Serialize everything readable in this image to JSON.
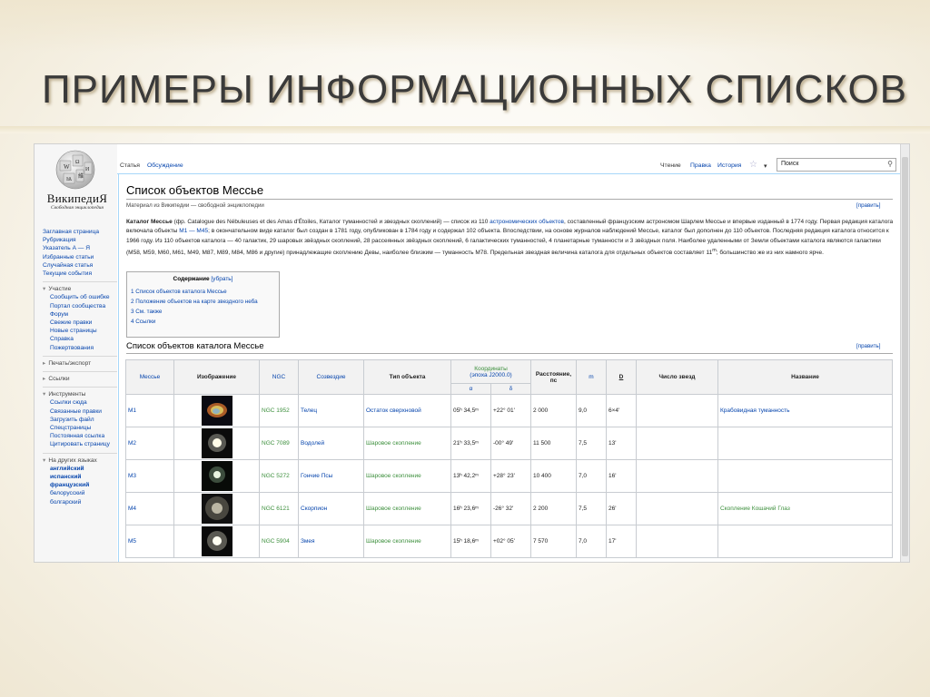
{
  "slide": {
    "title": "ПРИМЕРЫ ИНФОРМАЦИОННЫХ СПИСКОВ"
  },
  "logo": {
    "name": "ВикипедиЯ",
    "tagline": "Свободная энциклопедия"
  },
  "nav": {
    "main": [
      "Заглавная страница",
      "Рубрикация",
      "Указатель А — Я",
      "Избранные статьи",
      "Случайная статья",
      "Текущие события"
    ],
    "sections": [
      {
        "title": "Участие",
        "items": [
          "Сообщить об ошибке",
          "Портал сообщества",
          "Форум",
          "Свежие правки",
          "Новые страницы",
          "Справка",
          "Пожертвования"
        ]
      },
      {
        "title": "Печать/экспорт",
        "items": []
      },
      {
        "title": "Ссылки",
        "items": []
      },
      {
        "title": "Инструменты",
        "items": [
          "Ссылки сюда",
          "Связанные правки",
          "Загрузить файл",
          "Спецстраницы",
          "Постоянная ссылка",
          "Цитировать страницу"
        ]
      },
      {
        "title": "На других языках",
        "items": [
          "английский",
          "испанский",
          "французский",
          "белорусский",
          "болгарский"
        ]
      }
    ]
  },
  "tabs": {
    "article": "Статья",
    "discussion": "Обсуждение",
    "read": "Чтение",
    "edit": "Правка",
    "history": "История",
    "more": "▾"
  },
  "search": {
    "placeholder": "Поиск"
  },
  "article": {
    "title": "Список объектов Мессье",
    "from": "Материал из Википедии — свободной энциклопедии",
    "edit_label": "[править]",
    "intro": {
      "p1": "Каталог Мессье",
      "p2": " (фр. Catalogue des Nébuleuses et des Amas d'Étoiles, Каталог туманностей и звездных скоплений) — список из 110 ",
      "p3": "астрономических объектов",
      "p4": ", составленный французским астрономом Шарлем Мессье и впервые изданный в 1774 году. Первая редакция каталога включала объекты ",
      "p5": "М1 — М45",
      "p6": "; в окончательном виде каталог был создан в 1781 году, опубликован в 1784 году и содержал 102 объекта. Впоследствии, на основе журналов наблюдений Мессье, каталог был дополнен до 110 объектов. Последняя редакция каталога относится к 1966 году. Из 110 объектов каталога — 40 галактик, 29 шаровых звёздных скоплений, 28 рассеянных звёздных скоплений, 6 галактических туманностей, 4 планетарные туманности и 3 звёздных поля. Наиболее удаленными от Земли объектами каталога являются галактики (M58, M59, M60, M61, M49, M87, M89, M84, M86 и другие) принадлежащие скоплению Девы, наиболее близким — туманность М78. Предельная звездная величина каталога для отдельных объектов составляет 11",
      "p7": "m",
      "p8": "; большинство же из них намного ярче."
    },
    "toc": {
      "title": "Содержание",
      "hide": "[убрать]",
      "items": [
        "1 Список объектов каталога Мессье",
        "2 Положение объектов на карте звездного неба",
        "3 См. также",
        "4 Ссылки"
      ]
    },
    "section_title": "Список объектов каталога Мессье"
  },
  "table": {
    "headers": {
      "messier": "Мессье",
      "image": "Изображение",
      "ngc": "NGC",
      "constellation": "Созвездие",
      "type": "Тип объекта",
      "coords": "Координаты",
      "epoch": "(эпоха J2000.0)",
      "alpha": "α",
      "delta": "δ",
      "distance": "Расстояние, пс",
      "m": "m",
      "d": "D",
      "stars": "Число звезд",
      "name": "Название"
    },
    "rows": [
      {
        "messier": "M1",
        "ngc": "NGC 1952",
        "constellation": "Телец",
        "type": "Остаток сверхновой",
        "alpha": "05ʰ 34,5ᵐ",
        "delta": "+22° 01'",
        "distance": "2 000",
        "m": "9,0",
        "d": "6×4'",
        "stars": "",
        "name": "Крабовидная туманность"
      },
      {
        "messier": "M2",
        "ngc": "NGC 7089",
        "constellation": "Водолей",
        "type": "Шаровое скопление",
        "alpha": "21ʰ 33,5ᵐ",
        "delta": "-00° 49'",
        "distance": "11 500",
        "m": "7,5",
        "d": "13'",
        "stars": "",
        "name": ""
      },
      {
        "messier": "M3",
        "ngc": "NGC 5272",
        "constellation": "Гончие Псы",
        "type": "Шаровое скопление",
        "alpha": "13ʰ 42,2ᵐ",
        "delta": "+28° 23'",
        "distance": "10 400",
        "m": "7,0",
        "d": "16'",
        "stars": "",
        "name": ""
      },
      {
        "messier": "M4",
        "ngc": "NGC 6121",
        "constellation": "Скорпион",
        "type": "Шаровое скопление",
        "alpha": "16ʰ 23,6ᵐ",
        "delta": "-26° 32'",
        "distance": "2 200",
        "m": "7,5",
        "d": "26'",
        "stars": "",
        "name": "Скопление Кошачий Глаз"
      },
      {
        "messier": "M5",
        "ngc": "NGC 5904",
        "constellation": "Змея",
        "type": "Шаровое скопление",
        "alpha": "15ʰ 18,6ᵐ",
        "delta": "+02° 05'",
        "distance": "7 570",
        "m": "7,0",
        "d": "17'",
        "stars": "",
        "name": ""
      }
    ]
  }
}
